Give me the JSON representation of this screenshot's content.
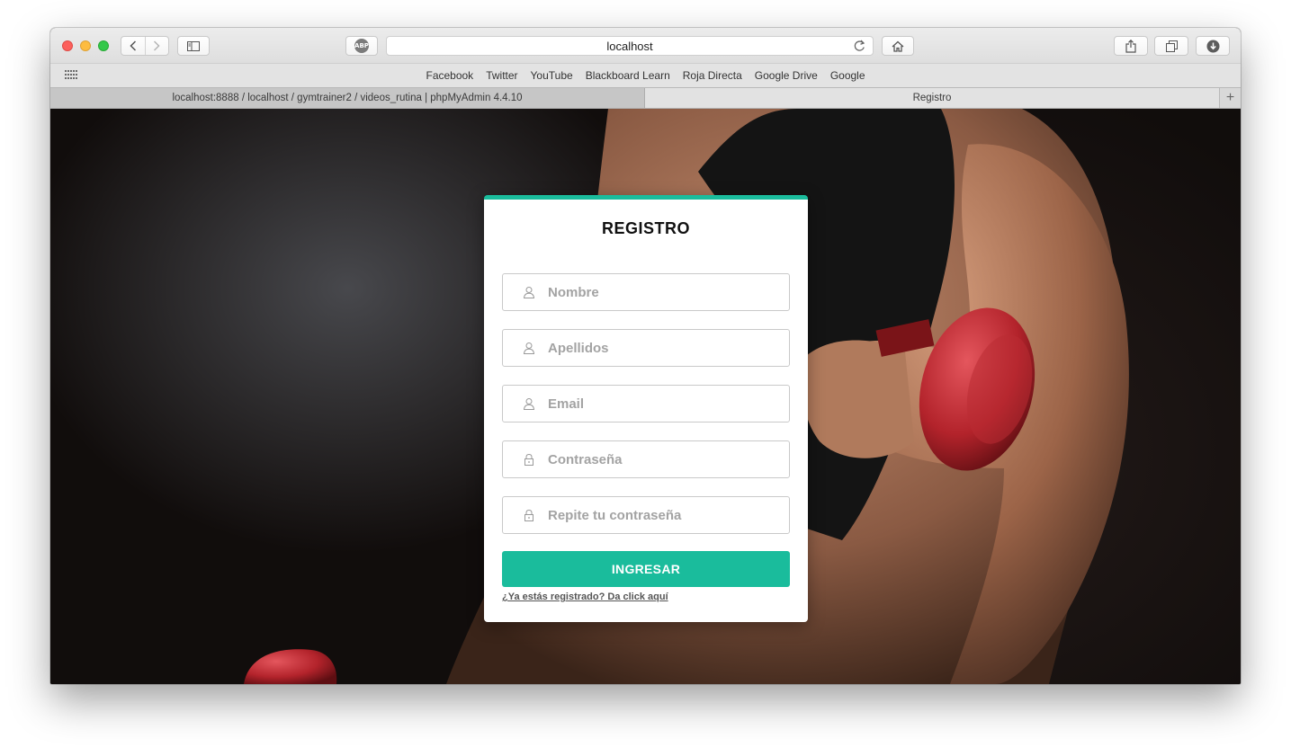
{
  "browser": {
    "url_text": "localhost",
    "adblock_label": "ABP",
    "bookmarks": [
      "Facebook",
      "Twitter",
      "YouTube",
      "Blackboard Learn",
      "Roja Directa",
      "Google Drive",
      "Google"
    ],
    "tabs": [
      {
        "label": "localhost:8888 / localhost / gymtrainer2 / videos_rutina | phpMyAdmin 4.4.10",
        "active": false
      },
      {
        "label": "Registro",
        "active": true
      }
    ],
    "new_tab_label": "+"
  },
  "form": {
    "title": "REGISTRO",
    "fields": [
      {
        "placeholder": "Nombre",
        "icon": "user-icon",
        "type": "text"
      },
      {
        "placeholder": "Apellidos",
        "icon": "user-icon",
        "type": "text"
      },
      {
        "placeholder": "Email",
        "icon": "user-icon",
        "type": "email"
      },
      {
        "placeholder": "Contraseña",
        "icon": "lock-icon",
        "type": "password"
      },
      {
        "placeholder": "Repite tu contraseña",
        "icon": "lock-icon",
        "type": "password"
      }
    ],
    "submit_label": "INGRESAR",
    "login_link": "¿Ya estás registrado? Da click aquí"
  },
  "colors": {
    "accent": "#1abc9c"
  }
}
